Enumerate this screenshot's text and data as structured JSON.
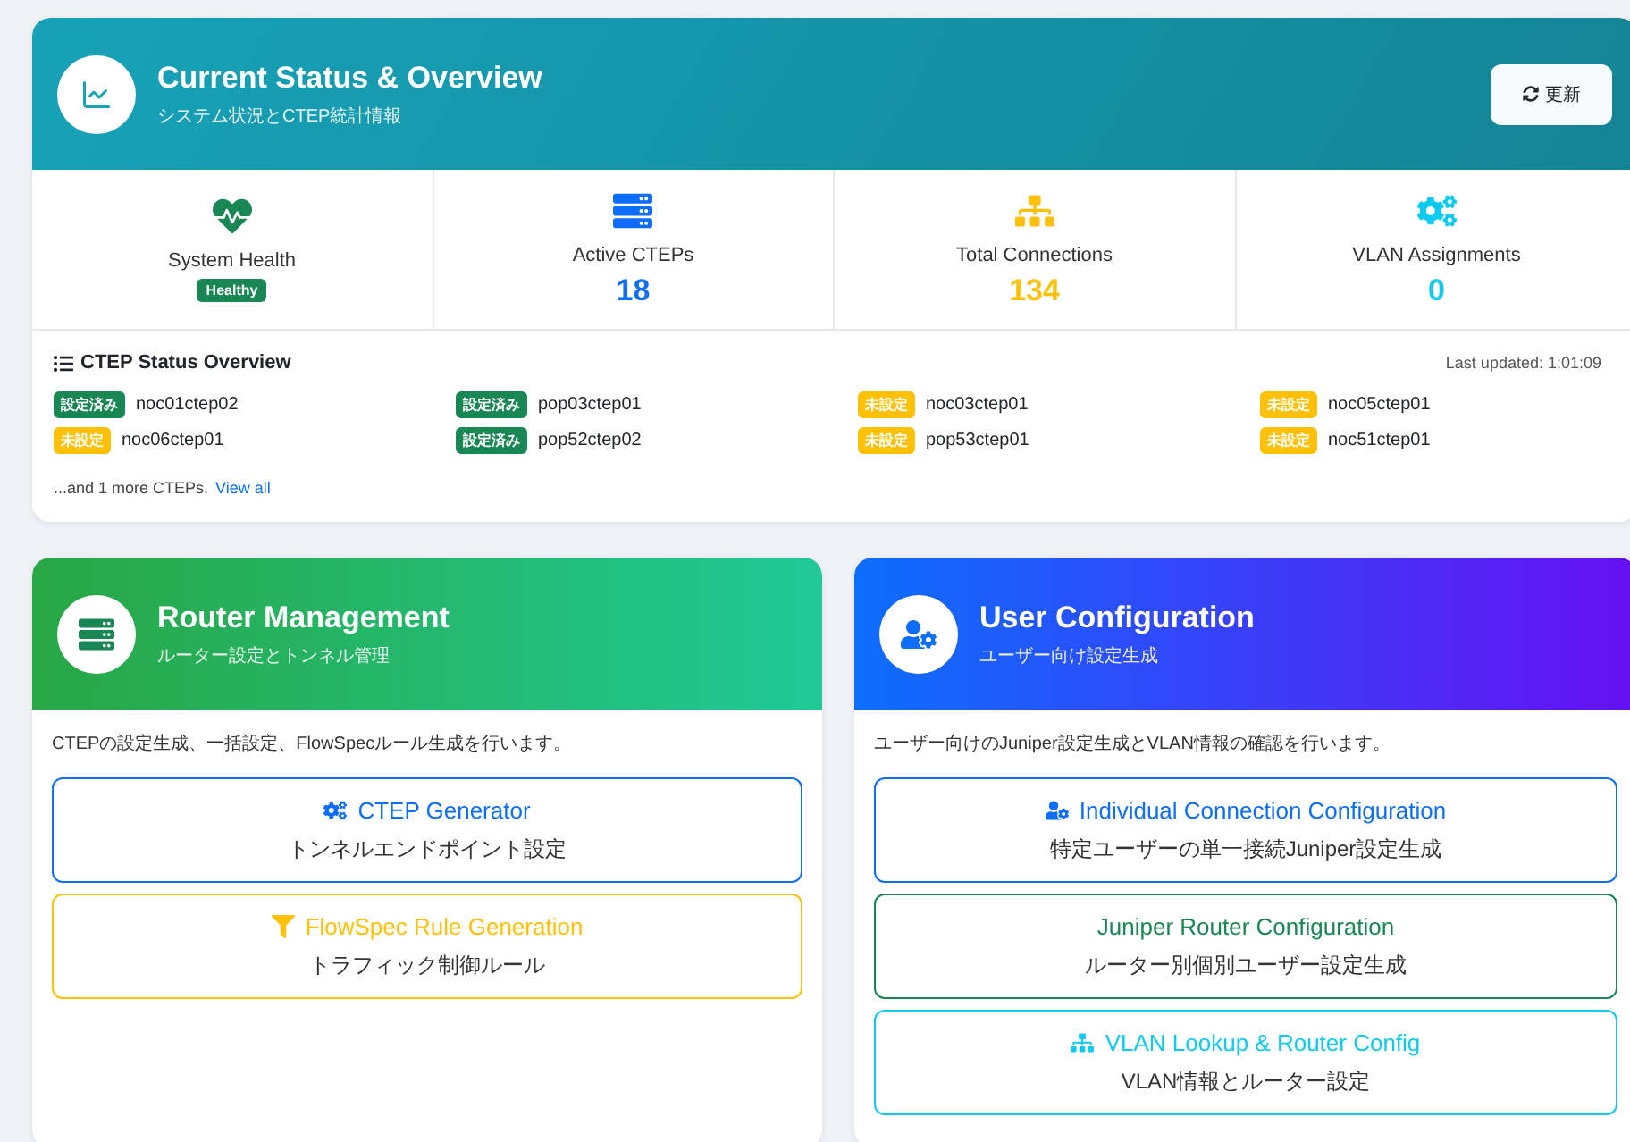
{
  "overview": {
    "title": "Current Status & Overview",
    "subtitle": "システム状況とCTEP統計情報",
    "refresh_button": "更新",
    "stats": [
      {
        "kind": "health",
        "label": "System Health",
        "badge": "Healthy",
        "color": "#198754"
      },
      {
        "kind": "ctep",
        "label": "Active CTEPs",
        "value": "18",
        "color": "#0d6efd"
      },
      {
        "kind": "connections",
        "label": "Total Connections",
        "value": "134",
        "color": "#ffc107"
      },
      {
        "kind": "vlan",
        "label": "VLAN Assignments",
        "value": "0",
        "color": "#0dcaf0"
      }
    ],
    "ctep_status": {
      "title": "CTEP Status Overview",
      "last_updated": "Last updated: 1:01:09",
      "items": [
        {
          "status": "設定済み",
          "kind": "configured",
          "name": "noc01ctep02"
        },
        {
          "status": "設定済み",
          "kind": "configured",
          "name": "pop03ctep01"
        },
        {
          "status": "未設定",
          "kind": "unconfigured",
          "name": "noc03ctep01"
        },
        {
          "status": "未設定",
          "kind": "unconfigured",
          "name": "noc05ctep01"
        },
        {
          "status": "未設定",
          "kind": "unconfigured",
          "name": "noc06ctep01"
        },
        {
          "status": "設定済み",
          "kind": "configured",
          "name": "pop52ctep02"
        },
        {
          "status": "未設定",
          "kind": "unconfigured",
          "name": "pop53ctep01"
        },
        {
          "status": "未設定",
          "kind": "unconfigured",
          "name": "noc51ctep01"
        }
      ],
      "more_text": "...and 1 more CTEPs.",
      "view_all_link": "View all"
    }
  },
  "panels": [
    {
      "kind": "router",
      "title": "Router Management",
      "subtitle": "ルーター設定とトンネル管理",
      "description": "CTEPの設定生成、一括設定、FlowSpecルール生成を行います。",
      "actions": [
        {
          "kind": "cogs",
          "title": "CTEP Generator",
          "subtitle": "トンネルエンドポイント設定",
          "color": "#0d6efd"
        },
        {
          "kind": "filter",
          "title": "FlowSpec Rule Generation",
          "subtitle": "トラフィック制御ルール",
          "color": "#ffc107"
        }
      ]
    },
    {
      "kind": "user",
      "title": "User Configuration",
      "subtitle": "ユーザー向け設定生成",
      "description": "ユーザー向けのJuniper設定生成とVLAN情報の確認を行います。",
      "actions": [
        {
          "kind": "user-cog",
          "title": "Individual Connection Configuration",
          "subtitle": "特定ユーザーの単一接続Juniper設定生成",
          "color": "#0d6efd"
        },
        {
          "kind": "none",
          "title": "Juniper Router Configuration",
          "subtitle": "ルーター別個別ユーザー設定生成",
          "color": "#198754"
        },
        {
          "kind": "sitemap",
          "title": "VLAN Lookup & Router Config",
          "subtitle": "VLAN情報とルーター設定",
          "color": "#0dcaf0"
        }
      ]
    }
  ]
}
